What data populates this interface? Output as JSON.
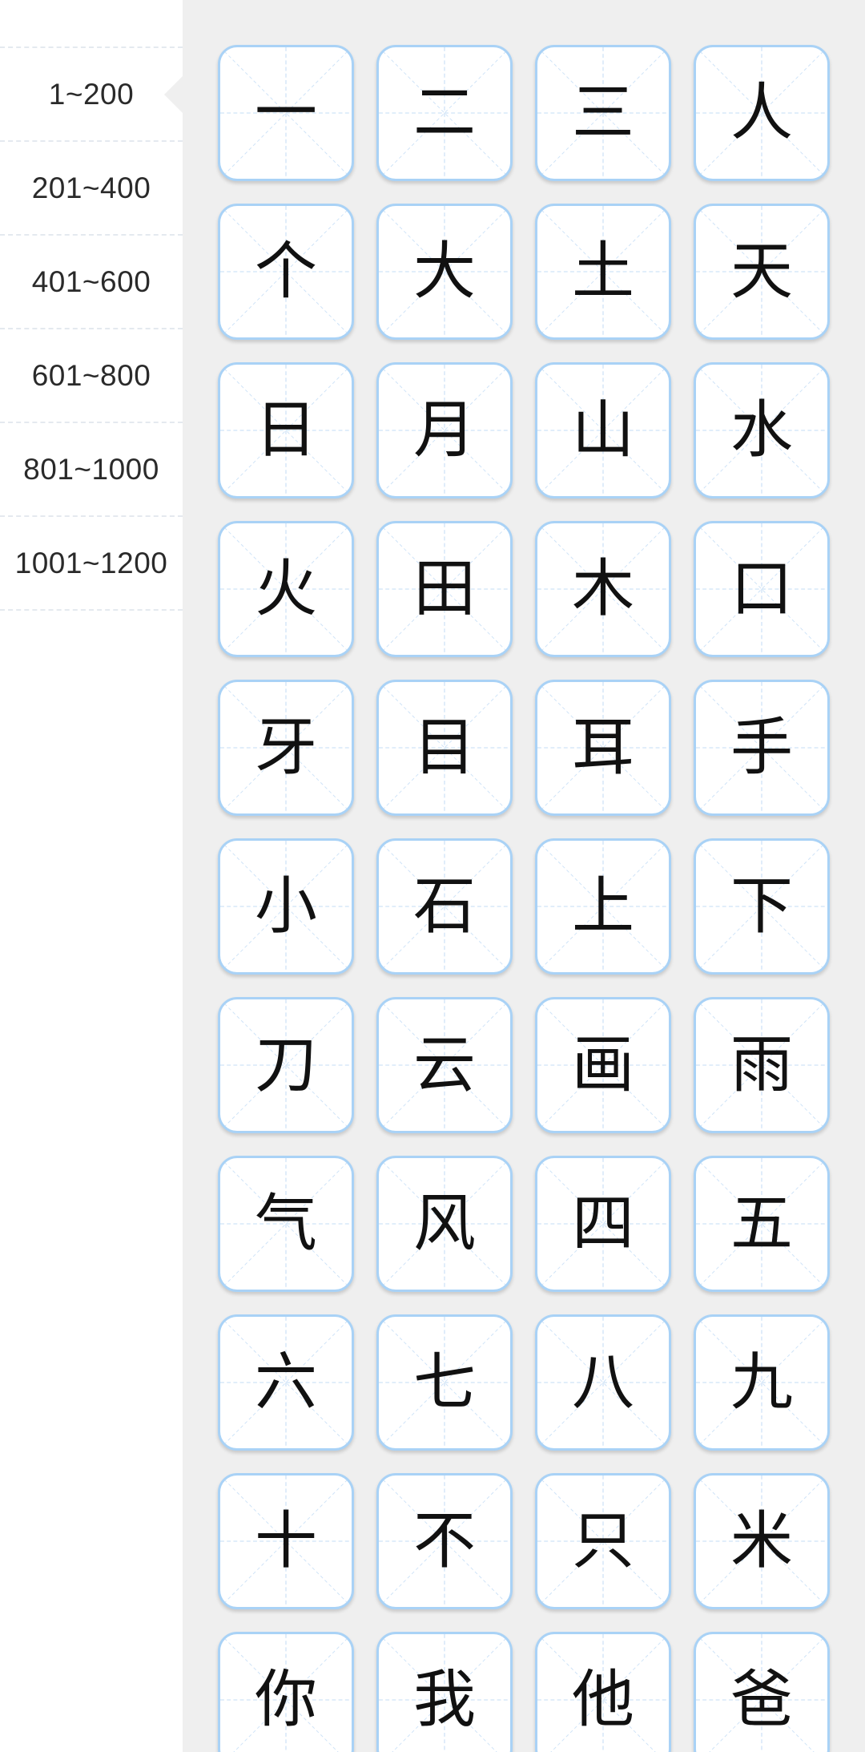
{
  "sidebar": {
    "selected_index": 0,
    "items": [
      {
        "label": "1~200"
      },
      {
        "label": "201~400"
      },
      {
        "label": "401~600"
      },
      {
        "label": "601~800"
      },
      {
        "label": "801~1000"
      },
      {
        "label": "1001~1200"
      }
    ]
  },
  "colors": {
    "card_border": "#a9d2f6",
    "guide_line": "#cfe3f7",
    "panel_background": "#efefef"
  },
  "characters": [
    "一",
    "二",
    "三",
    "人",
    "个",
    "大",
    "土",
    "天",
    "日",
    "月",
    "山",
    "水",
    "火",
    "田",
    "木",
    "口",
    "牙",
    "目",
    "耳",
    "手",
    "小",
    "石",
    "上",
    "下",
    "刀",
    "云",
    "画",
    "雨",
    "气",
    "风",
    "四",
    "五",
    "六",
    "七",
    "八",
    "九",
    "十",
    "不",
    "只",
    "米",
    "你",
    "我",
    "他",
    "爸"
  ]
}
